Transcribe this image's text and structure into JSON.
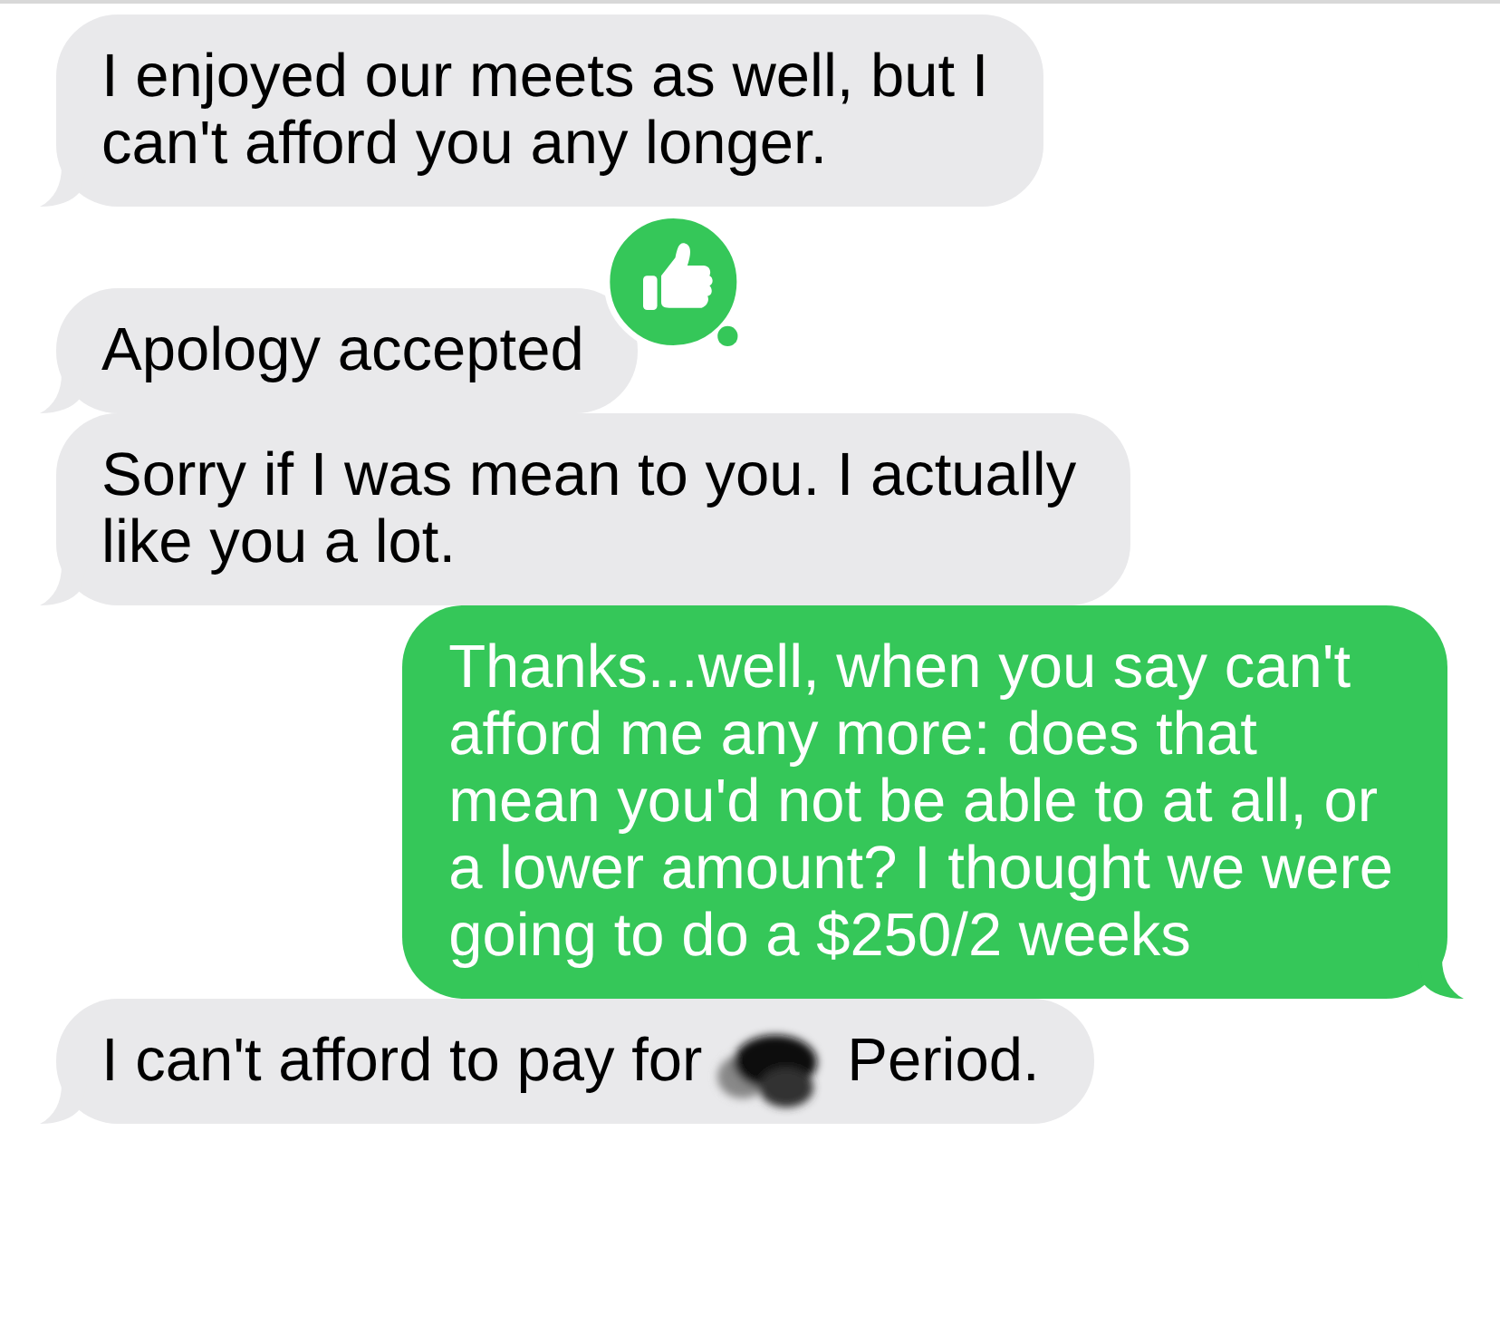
{
  "messages": [
    {
      "kind": "incoming",
      "parts": [
        {
          "kind": "text",
          "lines": [
            "I enjoyed our meets as well, but I",
            "can't afford you any longer."
          ]
        }
      ]
    },
    {
      "kind": "incoming",
      "tapback": {
        "kind": "thumbs-up"
      },
      "parts": [
        {
          "kind": "text",
          "lines": [
            "Apology accepted"
          ]
        }
      ]
    },
    {
      "kind": "incoming",
      "parts": [
        {
          "kind": "text",
          "lines": [
            "Sorry if I was mean to you. I actually",
            "like you a lot."
          ]
        }
      ]
    },
    {
      "kind": "outgoing",
      "parts": [
        {
          "kind": "text",
          "lines": [
            "Thanks...well, when you say can't",
            "afford me any more: does that",
            "mean you'd not be able to at all, or",
            "a lower amount? I thought we were",
            "going to do a $250/2 weeks"
          ]
        }
      ]
    },
    {
      "kind": "incoming",
      "parts": [
        {
          "kind": "text",
          "lines": [
            "I can't afford to pay for"
          ]
        },
        {
          "kind": "redacted"
        },
        {
          "kind": "text",
          "lines": [
            "Period."
          ]
        }
      ]
    }
  ]
}
